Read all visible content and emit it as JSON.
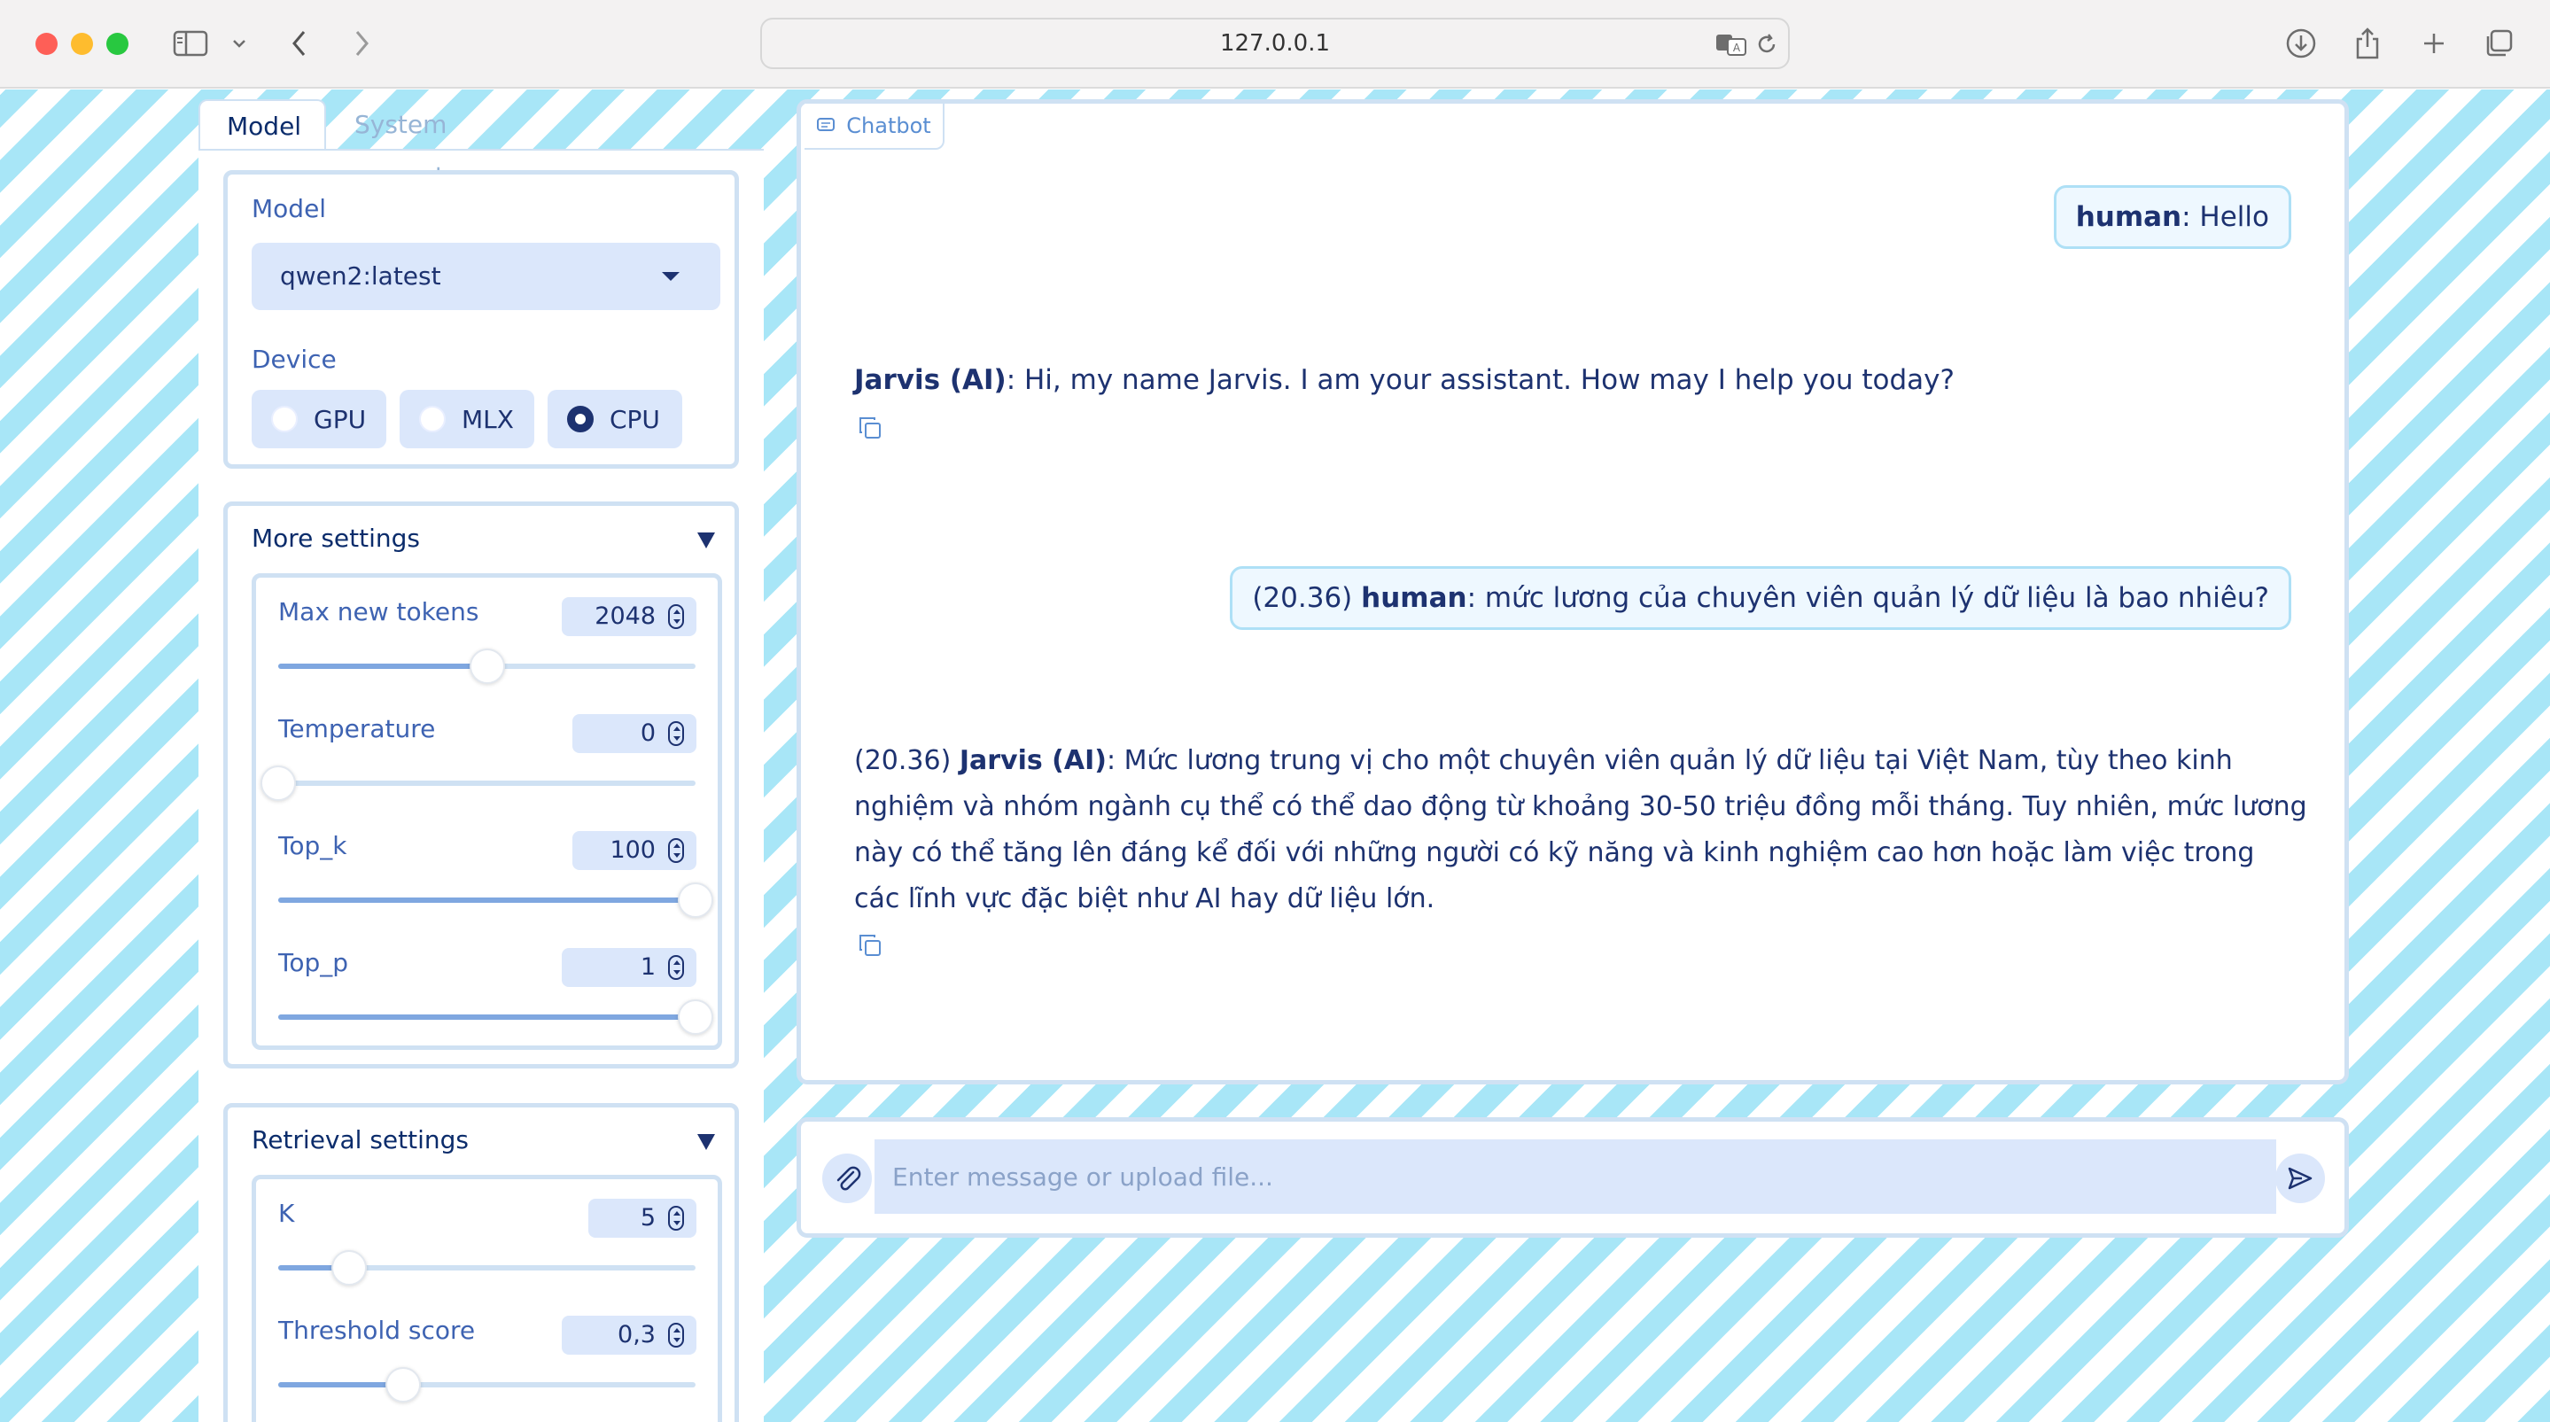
{
  "browser": {
    "url": "127.0.0.1",
    "icons": [
      "sidebar-icon",
      "chevron-down-icon",
      "back-icon",
      "forward-icon",
      "translate-icon",
      "reload-icon",
      "download-icon",
      "share-icon",
      "new-tab-icon",
      "tabs-overview-icon"
    ]
  },
  "tabs": [
    {
      "label": "Model",
      "active": true
    },
    {
      "label": "System prompt",
      "active": false
    }
  ],
  "model_card": {
    "model_label": "Model",
    "model_value": "qwen2:latest",
    "device_label": "Device",
    "devices": [
      {
        "label": "GPU",
        "selected": false
      },
      {
        "label": "MLX",
        "selected": false
      },
      {
        "label": "CPU",
        "selected": true
      }
    ]
  },
  "more_settings": {
    "title": "More settings",
    "sliders": [
      {
        "label": "Max new tokens",
        "value": "2048",
        "fraction": 0.5
      },
      {
        "label": "Temperature",
        "value": "0",
        "fraction": 0.0
      },
      {
        "label": "Top_k",
        "value": "100",
        "fraction": 1.0
      },
      {
        "label": "Top_p",
        "value": "1",
        "fraction": 1.0
      }
    ]
  },
  "retrieval_settings": {
    "title": "Retrieval settings",
    "sliders": [
      {
        "label": "K",
        "value": "5",
        "fraction": 0.17
      },
      {
        "label": "Threshold score",
        "value": "0,3",
        "fraction": 0.3
      }
    ]
  },
  "chat": {
    "badge": "Chatbot",
    "messages": [
      {
        "role": "human",
        "prefix": "",
        "speaker": "human",
        "text": ": Hello"
      },
      {
        "role": "ai",
        "prefix": "",
        "speaker": "Jarvis (AI)",
        "text": ": Hi, my name Jarvis. I am your assistant. How may I help you today?"
      },
      {
        "role": "human",
        "prefix": "(20.36) ",
        "speaker": "human",
        "text": ": mức lương của chuyên viên quản lý dữ liệu là bao nhiêu?"
      },
      {
        "role": "ai",
        "prefix": "(20.36) ",
        "speaker": "Jarvis (AI)",
        "text": ": Mức lương trung vị cho một chuyên viên quản lý dữ liệu tại Việt Nam, tùy theo kinh nghiệm và nhóm ngành cụ thể có thể dao động từ khoảng 30-50 triệu đồng mỗi tháng. Tuy nhiên, mức lương này có thể tăng lên đáng kể đối với những người có kỹ năng và kinh nghiệm cao hơn hoặc làm việc trong các lĩnh vực đặc biệt như AI hay dữ liệu lớn."
      }
    ]
  },
  "composer": {
    "placeholder": "Enter message or upload file..."
  },
  "colors": {
    "accent": "#1d3270",
    "label": "#3e63b2",
    "border": "#cfe1f3",
    "field": "#dbe7fb",
    "stripe": "#a8e6f7"
  }
}
